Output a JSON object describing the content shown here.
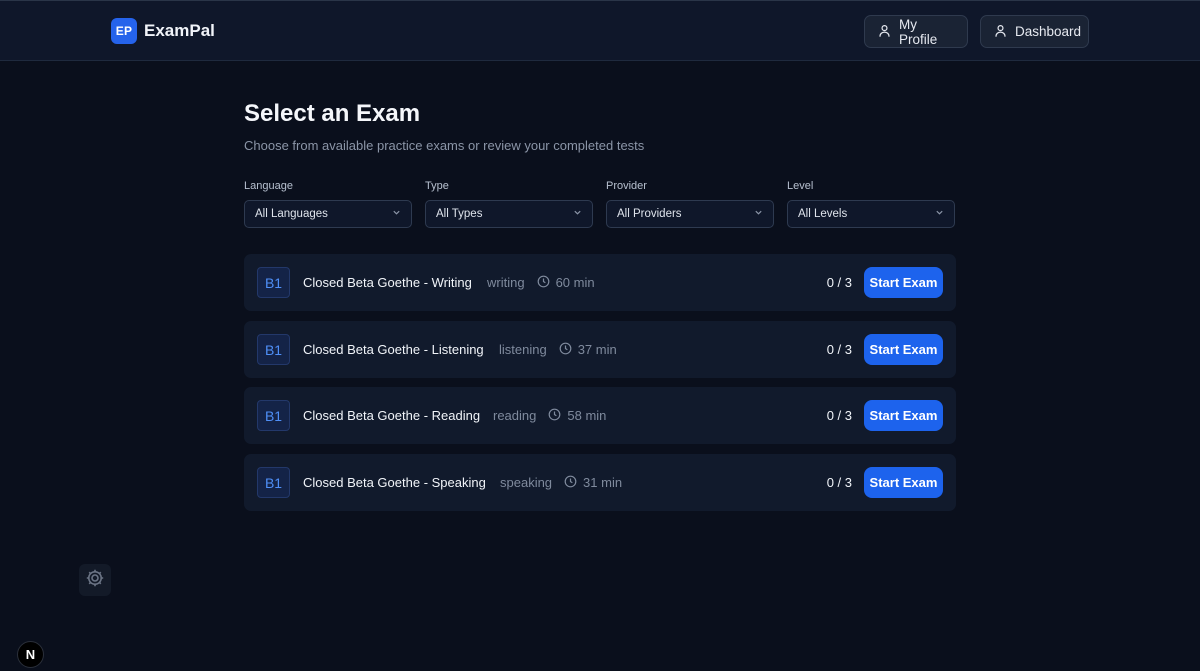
{
  "header": {
    "brand_badge": "EP",
    "brand_name": "ExamPal",
    "profile_label": "My Profile",
    "dashboard_label": "Dashboard"
  },
  "main": {
    "title": "Select an Exam",
    "subtitle": "Choose from available practice exams or review your completed tests"
  },
  "filters": [
    {
      "label": "Language",
      "value": "All Languages"
    },
    {
      "label": "Type",
      "value": "All Types"
    },
    {
      "label": "Provider",
      "value": "All Providers"
    },
    {
      "label": "Level",
      "value": "All Levels"
    }
  ],
  "exams": [
    {
      "level": "B1",
      "title": "Closed Beta Goethe - Writing",
      "type": "writing",
      "duration": "60 min",
      "attempts": "0 / 3",
      "action": "Start Exam"
    },
    {
      "level": "B1",
      "title": "Closed Beta Goethe - Listening",
      "type": "listening",
      "duration": "37 min",
      "attempts": "0 / 3",
      "action": "Start Exam"
    },
    {
      "level": "B1",
      "title": "Closed Beta Goethe - Reading",
      "type": "reading",
      "duration": "58 min",
      "attempts": "0 / 3",
      "action": "Start Exam"
    },
    {
      "level": "B1",
      "title": "Closed Beta Goethe - Speaking",
      "type": "speaking",
      "duration": "31 min",
      "attempts": "0 / 3",
      "action": "Start Exam"
    }
  ],
  "floating": {
    "dev_badge": "N",
    "gear_icon": "gear-icon"
  },
  "colors": {
    "background": "#0a0f1c",
    "accent": "#1d63ed",
    "card": "#111a2c"
  }
}
